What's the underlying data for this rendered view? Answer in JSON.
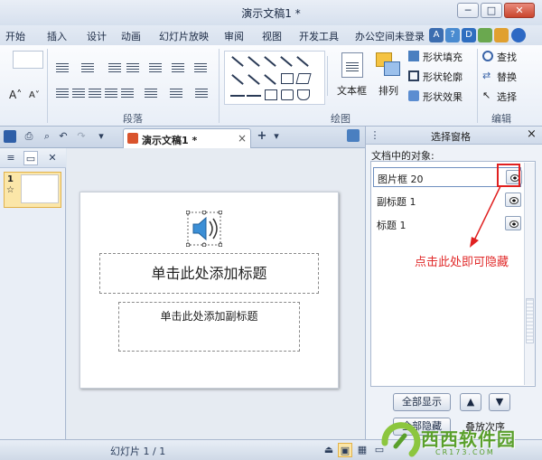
{
  "window": {
    "title": "演示文稿1 *",
    "minimize": "─",
    "maximize": "□",
    "close": "✕"
  },
  "tabs": [
    "开始",
    "插入",
    "设计",
    "动画",
    "幻灯片放映",
    "审阅",
    "视图",
    "开发工具",
    "办公空间",
    "未登录"
  ],
  "quick_icons": [
    "A",
    "?",
    "D"
  ],
  "ribbon": {
    "groups": {
      "paragraph": "段落",
      "drawing": "绘图",
      "editing": "编辑"
    },
    "text_box": "文本框",
    "arrange": "排列",
    "shape_fill": "形状填充",
    "shape_outline": "形状轮廓",
    "shape_effects": "形状效果",
    "find": "查找",
    "replace": "替换",
    "select": "选择"
  },
  "doc_tab": {
    "label": "演示文稿1 *",
    "close": "×",
    "new": "+"
  },
  "left_pane": {
    "slide_number": "1",
    "star": "☆"
  },
  "slide": {
    "title_placeholder": "单击此处添加标题",
    "subtitle_placeholder": "单击此处添加副标题"
  },
  "selection_pane": {
    "title": "选择窗格",
    "close": "×",
    "section_label": "文档中的对象:",
    "objects": [
      {
        "label": "图片框 20"
      },
      {
        "label": "副标题 1"
      },
      {
        "label": "标题 1"
      }
    ],
    "show_all": "全部显示",
    "hide_all": "全部隐藏",
    "reorder": "叠放次序",
    "up": "▲",
    "down": "▼"
  },
  "annotation": {
    "text": "点击此处即可隐藏",
    "color": "#e12a2a"
  },
  "status_bar": {
    "slide_info": "幻灯片 1 / 1"
  },
  "watermark": {
    "text": "西西软件园",
    "url": "CR173.COM"
  },
  "colors": {
    "accent": "#2b579a",
    "selection": "#fbe6a8"
  }
}
